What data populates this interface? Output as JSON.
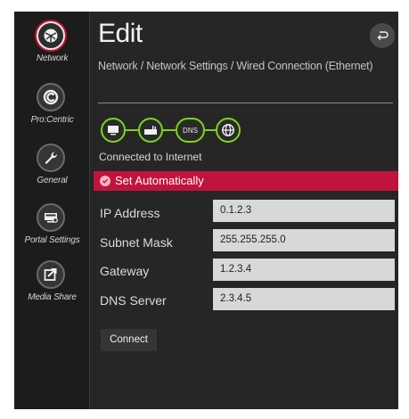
{
  "sidebar": {
    "items": [
      {
        "label": "Network",
        "icon": "network-icon",
        "active": true
      },
      {
        "label": "Pro:Centric",
        "icon": "procentric-icon",
        "active": false
      },
      {
        "label": "General",
        "icon": "wrench-icon",
        "active": false
      },
      {
        "label": "Portal Settings",
        "icon": "portal-icon",
        "active": false
      },
      {
        "label": "Media Share",
        "icon": "share-icon",
        "active": false
      }
    ]
  },
  "header": {
    "title": "Edit",
    "breadcrumb": "Network / Network Settings / Wired Connection (Ethernet)",
    "back_icon": "back-arrow-icon"
  },
  "connection": {
    "nodes": [
      "tv-icon",
      "router-icon",
      "DNS",
      "globe-icon"
    ],
    "dns_label": "DNS",
    "status": "Connected to Internet"
  },
  "auto_setting": {
    "label": "Set Automatically",
    "checked": true
  },
  "fields": [
    {
      "label": "IP Address",
      "value": "0.1.2.3"
    },
    {
      "label": "Subnet Mask",
      "value": "255.255.255.0"
    },
    {
      "label": "Gateway",
      "value": "1.2.3.4"
    },
    {
      "label": "DNS Server",
      "value": "2.3.4.5"
    }
  ],
  "actions": {
    "connect_label": "Connect"
  },
  "colors": {
    "accent": "#c0143c",
    "connected": "#7ed321",
    "background": "#262626"
  }
}
